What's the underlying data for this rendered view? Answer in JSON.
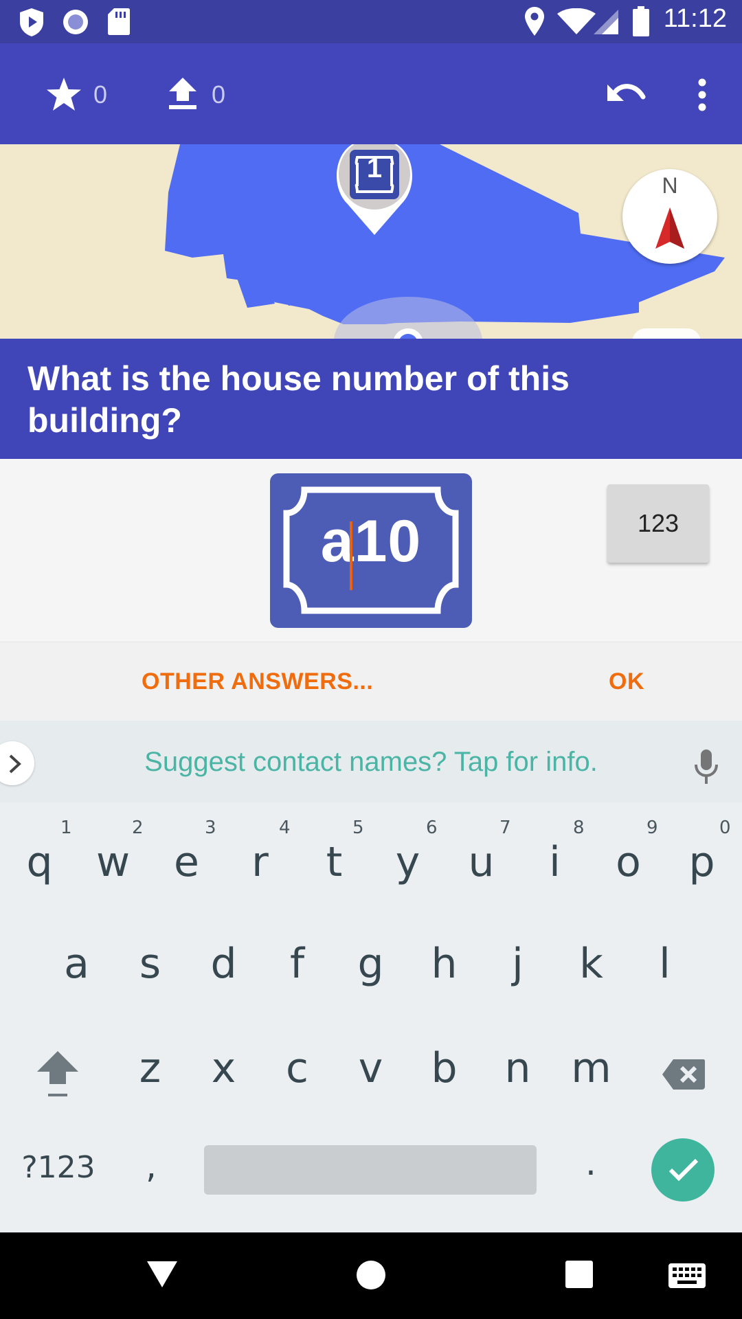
{
  "status_bar": {
    "time": "11:12",
    "left_icons": [
      "shield-play-icon",
      "circle-record-icon",
      "sd-card-icon"
    ],
    "right_icons": [
      "location-icon",
      "wifi-icon",
      "signal-icon",
      "battery-icon"
    ]
  },
  "toolbar": {
    "stars_count": "0",
    "uploads_count": "0",
    "icons": [
      "star-icon",
      "upload-icon",
      "undo-icon",
      "more-vert-icon"
    ]
  },
  "map": {
    "compass_label": "N",
    "marker_label": "1"
  },
  "question": {
    "text": "What is the house number of this building?"
  },
  "answer": {
    "value": "a10",
    "keyboard_toggle": "123"
  },
  "actions": {
    "other_answers": "OTHER ANSWERS...",
    "ok": "OK"
  },
  "suggestion": {
    "text": "Suggest contact names? Tap for info."
  },
  "keyboard": {
    "row1": [
      "q",
      "w",
      "e",
      "r",
      "t",
      "y",
      "u",
      "i",
      "o",
      "p"
    ],
    "row1_hints": [
      "1",
      "2",
      "3",
      "4",
      "5",
      "6",
      "7",
      "8",
      "9",
      "0"
    ],
    "row2": [
      "a",
      "s",
      "d",
      "f",
      "g",
      "h",
      "j",
      "k",
      "l"
    ],
    "row3": [
      "z",
      "x",
      "c",
      "v",
      "b",
      "n",
      "m"
    ],
    "symbols_key": "?123",
    "comma_key": ",",
    "period_key": "."
  },
  "colors": {
    "status_bar": "#3a3fa0",
    "toolbar": "#4246ba",
    "question_bg": "#4045b8",
    "accent_orange": "#f06d0f",
    "teal": "#3fb59e",
    "building_blue": "#4f6cf2"
  }
}
